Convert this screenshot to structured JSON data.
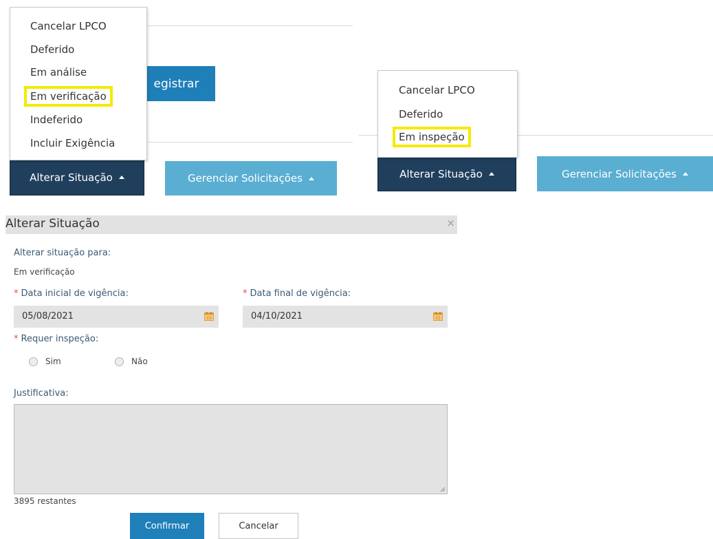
{
  "left_panel": {
    "menu_items": [
      "Cancelar LPCO",
      "Deferido",
      "Em análise",
      "Em verificação",
      "Indeferido",
      "Incluir Exigência"
    ],
    "highlighted_item": "Em verificação",
    "registrar_label": "egistrar",
    "alterar_label": "Alterar Situação",
    "gerenciar_label": "Gerenciar Solicitações"
  },
  "right_panel": {
    "menu_items": [
      "Cancelar LPCO",
      "Deferido",
      "Em inspeção"
    ],
    "highlighted_item": "Em inspeção",
    "alterar_label": "Alterar Situação",
    "gerenciar_label": "Gerenciar Solicitações"
  },
  "dialog": {
    "title": "Alterar Situação",
    "close_label": "×",
    "status_label": "Alterar situação para:",
    "status_value": "Em verificação",
    "required_mark": "*",
    "start_date_label": "Data inicial de vigência:",
    "start_date_value": "05/08/2021",
    "end_date_label": "Data final de vigência:",
    "end_date_value": "04/10/2021",
    "inspection_label": "Requer inspeção:",
    "radio_yes": "Sim",
    "radio_no": "Não",
    "justification_label": "Justificativa:",
    "justification_value": "",
    "remaining_text": "3895 restantes",
    "confirm_label": "Confirmar",
    "cancel_label": "Cancelar"
  },
  "colors": {
    "dark_button": "#1f3f5d",
    "light_button": "#5aaed2",
    "primary_button": "#1f7fb8",
    "highlight": "#f5ea00",
    "required": "#d9534f",
    "calendar_icon": "#e39b2b"
  }
}
